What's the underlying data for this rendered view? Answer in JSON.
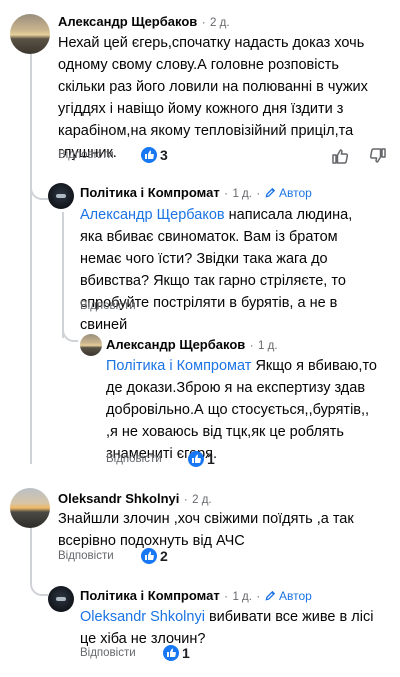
{
  "comments": [
    {
      "author": "Александр Щербаков",
      "time": "2 д.",
      "separator": "·",
      "text": "Нехай цей єгерь,спочатку надасть   доказ хочь одному свому слову.А головне розповість скільки раз його ловили на полюванні в чужих угіддях і навіщо йому кожного дня їздити з карабіном,на якому тепловізійний приціл,та глушник.",
      "reply_label": "Відповісти",
      "reactions": "3"
    },
    {
      "author": "Політика і Компромат",
      "time": "1 д.",
      "separator": "·",
      "badge": "Автор",
      "mention": "Александр Щербаков",
      "text": " написала людина, яка вбиває свиноматок. Вам із братом немає чого їсти? Звідки така жага до вбивства? Якщо так гарно стріляєте, то спробуйте постріляти в бурятів, а не в свиней",
      "reply_label": "Відповісти"
    },
    {
      "author": "Александр Щербаков",
      "time": "1 д.",
      "separator": "·",
      "mention": "Політика і Компромат",
      "text": " Якщо я вбиваю,то де докази.Зброю я на експертизу здав добровільно.А що стосується,,бурятів,, ,я не ховаюсь від тцк,як це роблять знамениті єгеря.",
      "reply_label": "Відповісти",
      "reactions": "1"
    },
    {
      "author": "Oleksandr Shkolnyi",
      "time": "2 д.",
      "separator": "·",
      "text": "Знайшли злочин ,хоч свіжими поїдять ,а так всерівно подохнуть від АЧС",
      "reply_label": "Відповісти",
      "reactions": "2"
    },
    {
      "author": "Політика і Компромат",
      "time": "1 д.",
      "separator": "·",
      "badge": "Автор",
      "mention": "Oleksandr Shkolnyi",
      "text": " вибивати все живе в лісі це хіба не злочин?",
      "reply_label": "Відповісти",
      "reactions": "1"
    }
  ],
  "colors": {
    "accent": "#1b74e4",
    "like_badge": "#1877f2",
    "meta": "#65676b"
  },
  "icons": [
    "like-icon",
    "dislike-icon",
    "pencil-icon",
    "thumbs-up-badge-icon"
  ]
}
